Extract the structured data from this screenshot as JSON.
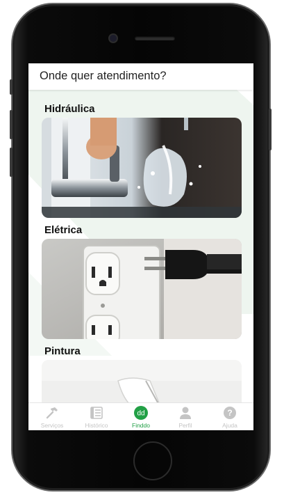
{
  "header": {
    "title": "Onde quer atendimento?"
  },
  "sections": [
    {
      "title": "Hidráulica",
      "image": "faucet-water-splash"
    },
    {
      "title": "Elétrica",
      "image": "power-outlet-plug"
    },
    {
      "title": "Pintura",
      "image": "paint-roller"
    }
  ],
  "tabbar": {
    "tabs": [
      {
        "label": "Serviços",
        "icon": "hammer-icon",
        "active": false
      },
      {
        "label": "Histórico",
        "icon": "list-icon",
        "active": false
      },
      {
        "label": "Finddo",
        "icon": "finddo-logo-icon",
        "logo_text": "dd",
        "active": true
      },
      {
        "label": "Perfil",
        "icon": "person-icon",
        "active": false
      },
      {
        "label": "Ajuda",
        "icon": "help-icon",
        "active": false
      }
    ]
  },
  "colors": {
    "accent": "#22a046",
    "inactive": "#c4c4c4",
    "background_tint": "#eef5ef"
  }
}
